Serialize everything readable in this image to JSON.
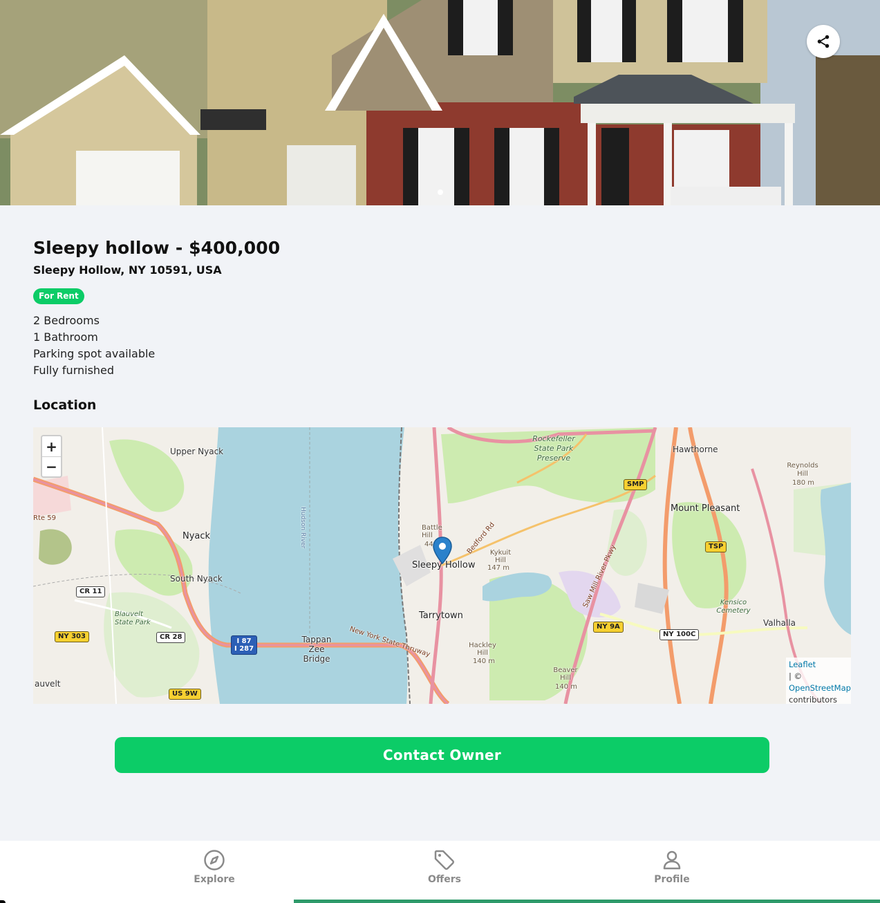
{
  "listing": {
    "title": "Sleepy hollow - $400,000",
    "address": "Sleepy Hollow, NY 10591, USA",
    "badge": "For Rent",
    "features": [
      "2 Bedrooms",
      "1 Bathroom",
      "Parking spot available",
      "Fully furnished"
    ]
  },
  "location": {
    "heading": "Location"
  },
  "map": {
    "zoom_in": "+",
    "zoom_out": "−",
    "labels": {
      "upper_nyack": "Upper Nyack",
      "nyack": "Nyack",
      "south_nyack": "South Nyack",
      "blauvelt_park": "Blauvelt State Park",
      "blauvelt": "auvelt",
      "tappan": "Tappan Zee Bridge",
      "sleepy_hollow": "Sleepy Hollow",
      "tarrytown": "Tarrytown",
      "battle_hill": "Battle Hill",
      "battle_hill_elev": "44",
      "kykuit": "Kykuit Hill",
      "kykuit_elev": "147 m",
      "hackley": "Hackley Hill",
      "hackley_elev": "140 m",
      "beaver": "Beaver Hill",
      "beaver_elev": "140 m",
      "rockefeller": "Rockefeller State Park Preserve",
      "hawthorne": "Hawthorne",
      "mount_pleasant": "Mount Pleasant",
      "reynolds": "Reynolds Hill",
      "reynolds_elev": "180 m",
      "kensico": "Kensico Cemetery",
      "valhalla": "Valhalla",
      "hudson": "Hudson River",
      "ny_thruway": "New York State Thruway",
      "bedford_rd": "Bedford Rd",
      "saw_mill": "Saw Mill River Pkwy",
      "rte59": "Rte 59",
      "rte_b": "Rte 59"
    },
    "shields": {
      "ny303": "NY 303",
      "cr11": "CR 11",
      "cr28": "CR 28",
      "us9w": "US 9W",
      "i87": "I 87",
      "i287": "I 287",
      "ny9a": "NY 9A",
      "ny100c": "NY 100C",
      "smp": "SMP",
      "tsp": "TSP"
    },
    "attribution": {
      "leaflet": "Leaflet",
      "sep": "| ©",
      "osm": "OpenStreetMap",
      "contributors": "contributors"
    }
  },
  "actions": {
    "contact": "Contact Owner"
  },
  "nav": {
    "explore": "Explore",
    "offers": "Offers",
    "profile": "Profile",
    "active": "offers"
  },
  "colors": {
    "accent": "#0ccc67",
    "nav_indicator": "#2e9a6a",
    "water": "#aad3df",
    "park": "#cdebb0"
  }
}
